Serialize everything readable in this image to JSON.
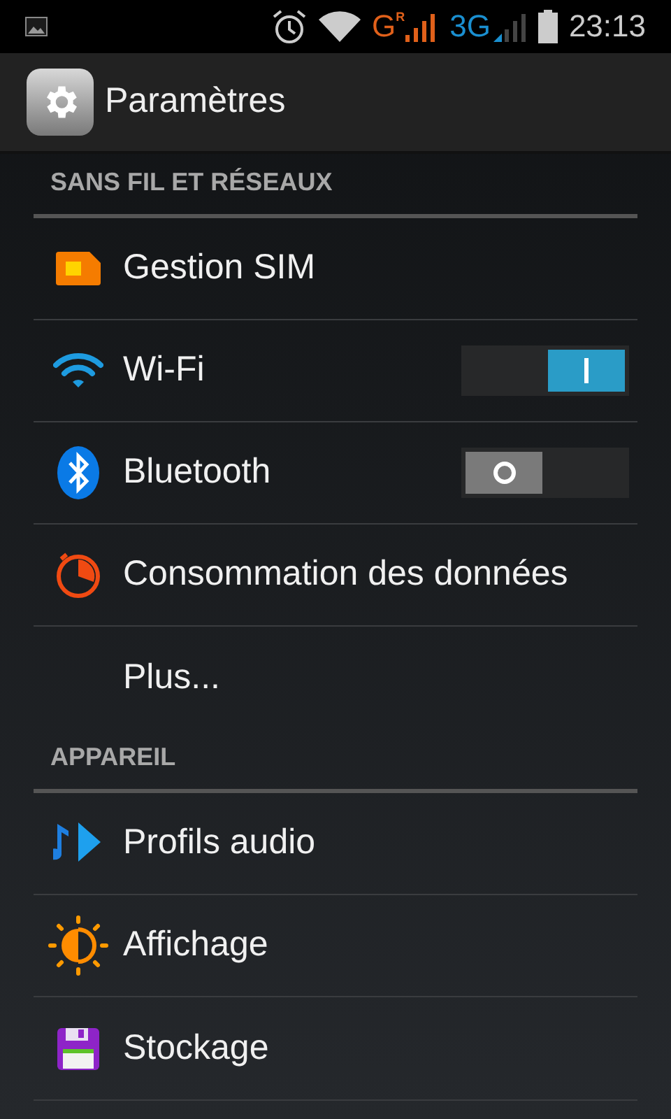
{
  "status_bar": {
    "network_1": "G",
    "roaming": "R",
    "network_2": "3G",
    "time": "23:13"
  },
  "action_bar": {
    "title": "Paramètres"
  },
  "sections": [
    {
      "title": "SANS FIL ET RÉSEAUX",
      "items": [
        {
          "label": "Gestion SIM",
          "kind": "plain"
        },
        {
          "label": "Wi-Fi",
          "kind": "toggle",
          "on": true
        },
        {
          "label": "Bluetooth",
          "kind": "toggle",
          "on": false
        },
        {
          "label": "Consommation des données",
          "kind": "plain"
        },
        {
          "label": "Plus...",
          "kind": "plain"
        }
      ]
    },
    {
      "title": "APPAREIL",
      "items": [
        {
          "label": "Profils audio",
          "kind": "plain"
        },
        {
          "label": "Affichage",
          "kind": "plain"
        },
        {
          "label": "Stockage",
          "kind": "plain"
        }
      ]
    }
  ]
}
